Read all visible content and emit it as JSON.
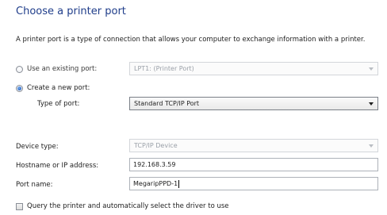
{
  "heading": "Choose a printer port",
  "description": "A printer port is a type of connection that allows your computer to exchange information with a printer.",
  "existing_port": {
    "label": "Use an existing port:",
    "selected": false,
    "value": "LPT1: (Printer Port)",
    "enabled": false
  },
  "new_port": {
    "label": "Create a new port:",
    "selected": true,
    "type_label": "Type of port:",
    "type_value": "Standard TCP/IP Port"
  },
  "device_type": {
    "label": "Device type:",
    "value": "TCP/IP Device",
    "enabled": false
  },
  "hostname": {
    "label": "Hostname or IP address:",
    "value": "192.168.3.59"
  },
  "port_name": {
    "label": "Port name:",
    "value": "MegaripPPD-1"
  },
  "query_printer": {
    "label": "Query the printer and automatically select the driver to use",
    "checked": false
  },
  "colors": {
    "heading": "#1f3d8a",
    "radio_selected": "#1d5bbf"
  }
}
